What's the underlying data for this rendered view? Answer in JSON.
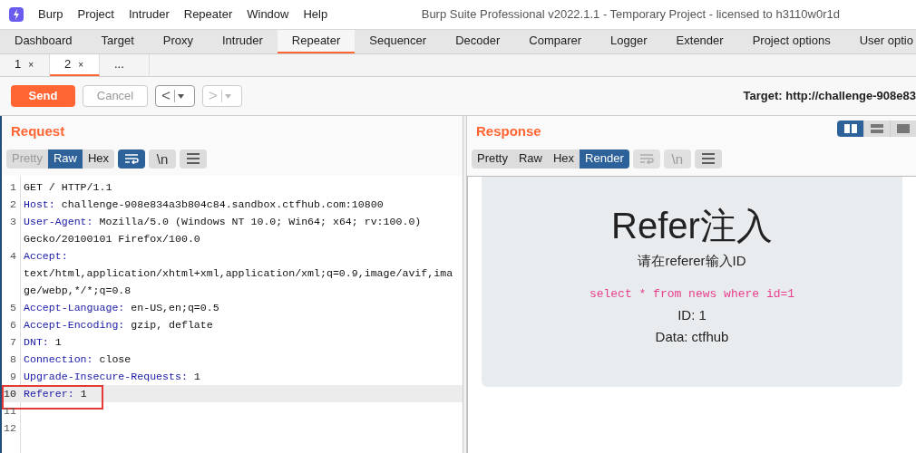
{
  "menu": [
    "Burp",
    "Project",
    "Intruder",
    "Repeater",
    "Window",
    "Help"
  ],
  "window": {
    "title": "Burp Suite Professional v2022.1.1 - Temporary Project - licensed to h3110w0r1d"
  },
  "tabs": [
    {
      "label": "Dashboard",
      "selected": false
    },
    {
      "label": "Target",
      "selected": false
    },
    {
      "label": "Proxy",
      "selected": false
    },
    {
      "label": "Intruder",
      "selected": false
    },
    {
      "label": "Repeater",
      "selected": true
    },
    {
      "label": "Sequencer",
      "selected": false
    },
    {
      "label": "Decoder",
      "selected": false
    },
    {
      "label": "Comparer",
      "selected": false
    },
    {
      "label": "Logger",
      "selected": false
    },
    {
      "label": "Extender",
      "selected": false
    },
    {
      "label": "Project options",
      "selected": false
    },
    {
      "label": "User optio",
      "selected": false
    }
  ],
  "sub_tabs": [
    {
      "label": "1",
      "close": "×",
      "selected": false
    },
    {
      "label": "2",
      "close": "×",
      "selected": true
    },
    {
      "label": "...",
      "selected": false
    }
  ],
  "toolbar": {
    "send": "Send",
    "cancel": "Cancel",
    "back": "<",
    "forward": ">",
    "target": "Target: http://challenge-908e83"
  },
  "layout_buttons": [
    {
      "selected": true
    },
    {
      "selected": false
    },
    {
      "selected": false
    }
  ],
  "request": {
    "title": "Request",
    "views": [
      {
        "label": "Pretty",
        "selected": false,
        "disabled": true
      },
      {
        "label": "Raw",
        "selected": true,
        "disabled": false
      },
      {
        "label": "Hex",
        "selected": false,
        "disabled": false
      }
    ],
    "tools": [
      {
        "kind": "wrap",
        "on": true,
        "disabled": false
      },
      {
        "kind": "newline",
        "label": "\\n",
        "on": false,
        "disabled": false
      },
      {
        "kind": "menu",
        "on": false,
        "disabled": false
      }
    ],
    "lines": [
      {
        "number": "1",
        "value": "GET / HTTP/1.1",
        "highlighted": false,
        "marked": false
      },
      {
        "number": "2",
        "key": "Host:",
        "value": "challenge-908e834a3b804c84.sandbox.ctfhub.com:10800",
        "highlighted": false,
        "marked": false
      },
      {
        "number": "3",
        "key": "User-Agent:",
        "value": "Mozilla/5.0 (Windows NT 10.0; Win64; x64; rv:100.0) Gecko/20100101 Firefox/100.0",
        "highlighted": false,
        "marked": false
      },
      {
        "number": "4",
        "key": "Accept:",
        "value": "text/html,application/xhtml+xml,application/xml;q=0.9,image/avif,image/webp,*/*;q=0.8",
        "highlighted": false,
        "marked": false
      },
      {
        "number": "5",
        "key": "Accept-Language:",
        "value": "en-US,en;q=0.5",
        "highlighted": false,
        "marked": false
      },
      {
        "number": "6",
        "key": "Accept-Encoding:",
        "value": "gzip, deflate",
        "highlighted": false,
        "marked": false
      },
      {
        "number": "7",
        "key": "DNT:",
        "value": "1",
        "highlighted": false,
        "marked": false
      },
      {
        "number": "8",
        "key": "Connection:",
        "value": "close",
        "highlighted": false,
        "marked": false
      },
      {
        "number": "9",
        "key": "Upgrade-Insecure-Requests:",
        "value": "1",
        "highlighted": false,
        "marked": false
      },
      {
        "number": "10",
        "key": "Referer:",
        "value": "1",
        "highlighted": true,
        "marked": true
      },
      {
        "number": "11",
        "highlighted": false,
        "marked": false
      },
      {
        "number": "12",
        "highlighted": false,
        "marked": false
      }
    ]
  },
  "response": {
    "title": "Response",
    "views": [
      {
        "label": "Pretty",
        "selected": false,
        "disabled": false
      },
      {
        "label": "Raw",
        "selected": false,
        "disabled": false
      },
      {
        "label": "Hex",
        "selected": false,
        "disabled": false
      },
      {
        "label": "Render",
        "selected": true,
        "disabled": false
      }
    ],
    "tools": [
      {
        "kind": "wrap",
        "on": false,
        "disabled": true
      },
      {
        "kind": "newline",
        "label": "\\n",
        "on": false,
        "disabled": true
      },
      {
        "kind": "menu",
        "on": false,
        "disabled": false
      }
    ],
    "render": {
      "heading": "Refer注入",
      "subtitle": "请在referer输入ID",
      "query": "select * from news where id=1",
      "lines": [
        "ID: 1",
        "Data: ctfhub"
      ]
    }
  }
}
